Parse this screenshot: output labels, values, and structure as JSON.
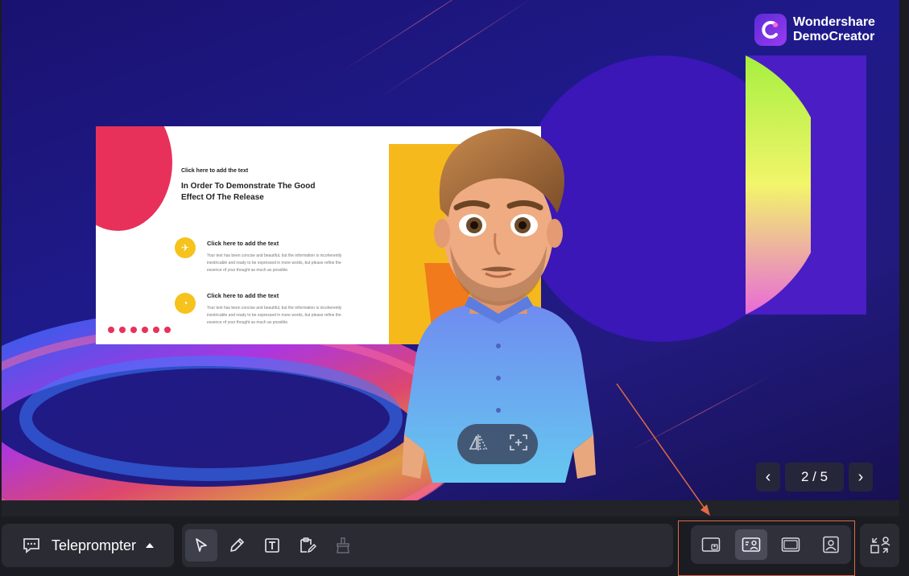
{
  "brand": {
    "line1": "Wondershare",
    "line2": "DemoCreator"
  },
  "slide": {
    "small_label": "Click here to add the text",
    "heading": "In Order To Demonstrate The Good Effect Of The Release",
    "items": [
      {
        "title": "Click here to add the text",
        "body": "Your text has been concise and beautiful, but the information is incoherently inextricable and ready to be expressed in more words, but please refine the essence of your thought as much as possible."
      },
      {
        "title": "Click here to add the text",
        "body": "Your text has been concise and beautiful, but the information is incoherently inextricable and ready to be expressed in more words, but please refine the essence of your thought as much as possible."
      }
    ]
  },
  "avatar_controls": {
    "flip_icon": "flip-horizontal-icon",
    "crop_icon": "crop-frame-icon"
  },
  "pager": {
    "label": "2 / 5",
    "prev_icon": "chevron-left-icon",
    "next_icon": "chevron-right-icon"
  },
  "toolbar": {
    "teleprompter_label": "Teleprompter",
    "tools": [
      "cursor-icon",
      "pen-icon",
      "text-icon",
      "clipboard-edit-icon",
      "eraser-icon"
    ],
    "layouts": [
      "screen-with-small-avatar-icon",
      "screen-with-avatar-icon",
      "screen-only-icon",
      "avatar-only-icon"
    ],
    "active_layout": 1
  },
  "colors": {
    "accent_annotation": "#e06a44",
    "bg_stage": "#1f1a8a",
    "slide_pink": "#e8315a",
    "slide_yellow": "#f6b91c"
  }
}
